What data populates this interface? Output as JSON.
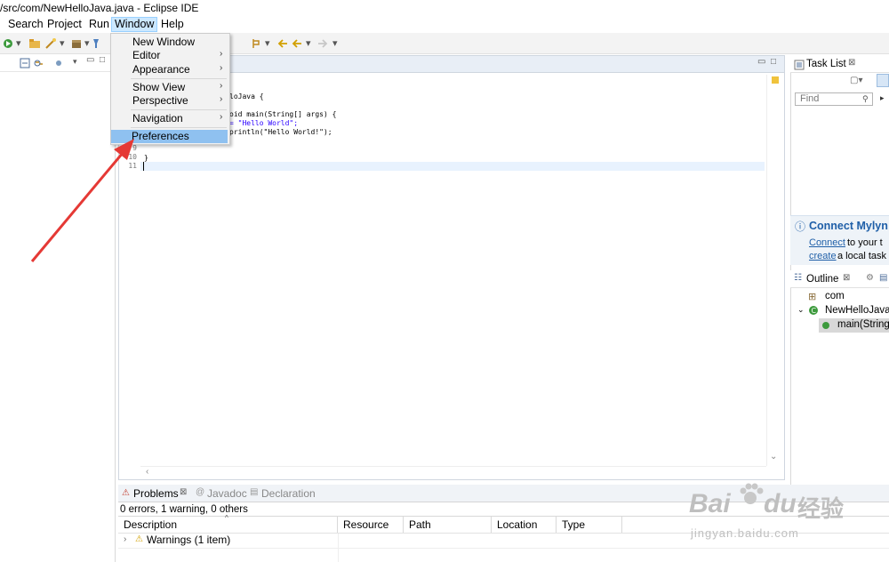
{
  "window": {
    "title": "/src/com/NewHelloJava.java - Eclipse IDE"
  },
  "menubar": [
    "Search",
    "Project",
    "Run",
    "Window",
    "Help"
  ],
  "window_menu": {
    "items": [
      {
        "label": "New Window",
        "submenu": false
      },
      {
        "label": "Editor",
        "submenu": true
      },
      {
        "label": "Appearance",
        "submenu": true
      },
      {
        "label": "Show View",
        "submenu": true
      },
      {
        "label": "Perspective",
        "submenu": true
      },
      {
        "label": "Navigation",
        "submenu": true
      },
      {
        "label": "Preferences",
        "submenu": false,
        "highlighted": true
      }
    ],
    "arrow_glyph": "›"
  },
  "editor": {
    "line_numbers": [
      "9",
      "10",
      "11"
    ],
    "code_lines": [
      "loJava {",
      "oid main(String[] args) {",
      "= \"Hello World\";",
      "println(\"Hello World!\");",
      "}"
    ]
  },
  "task_list": {
    "tab_label": "Task List",
    "find_placeholder": "Find",
    "connect_title": "Connect Mylyn",
    "connect_link": "Connect",
    "connect_text": " to your t",
    "create_link": "create",
    "create_text": " a local task"
  },
  "outline": {
    "tab_label": "Outline",
    "items": [
      "com",
      "NewHelloJava",
      "main(String"
    ]
  },
  "bottom_panel": {
    "tabs": [
      "Problems",
      "Javadoc",
      "Declaration"
    ],
    "summary": "0 errors, 1 warning, 0 others",
    "columns": [
      "Description",
      "Resource",
      "Path",
      "Location",
      "Type"
    ],
    "rows": [
      {
        "label": "Warnings (1 item)"
      }
    ]
  },
  "watermark": {
    "brand": "Bai",
    "brand2": "du",
    "cn": "经验",
    "url": "jingyan.baidu.com"
  },
  "colors": {
    "highlight": "#8fc1f0",
    "menu_active": "#cce8ff",
    "arrow": "#e53935",
    "link": "#1f5fa8"
  }
}
